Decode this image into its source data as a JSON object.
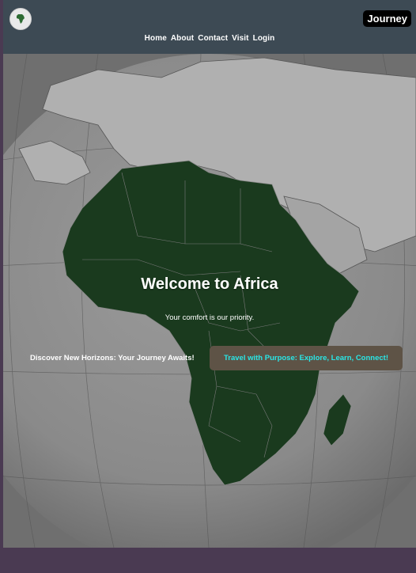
{
  "colors": {
    "page_background": "#4a3a52",
    "header_background": "#3d4a54",
    "africa_fill": "#1a3a1e",
    "button_background": "#5e5346",
    "button_text": "#29e6e6"
  },
  "header": {
    "brand": "Journey",
    "logo_icon": "africa-globe-icon",
    "nav": [
      {
        "label": "Home"
      },
      {
        "label": "About"
      },
      {
        "label": "Contact"
      },
      {
        "label": "Visit"
      },
      {
        "label": "Login"
      }
    ]
  },
  "hero": {
    "title": "Welcome to Africa",
    "subtitle": "Your comfort is our priority.",
    "discover_text": "Discover New Horizons: Your Journey Awaits!",
    "cta_label": "Travel with Purpose: Explore, Learn, Connect!"
  }
}
